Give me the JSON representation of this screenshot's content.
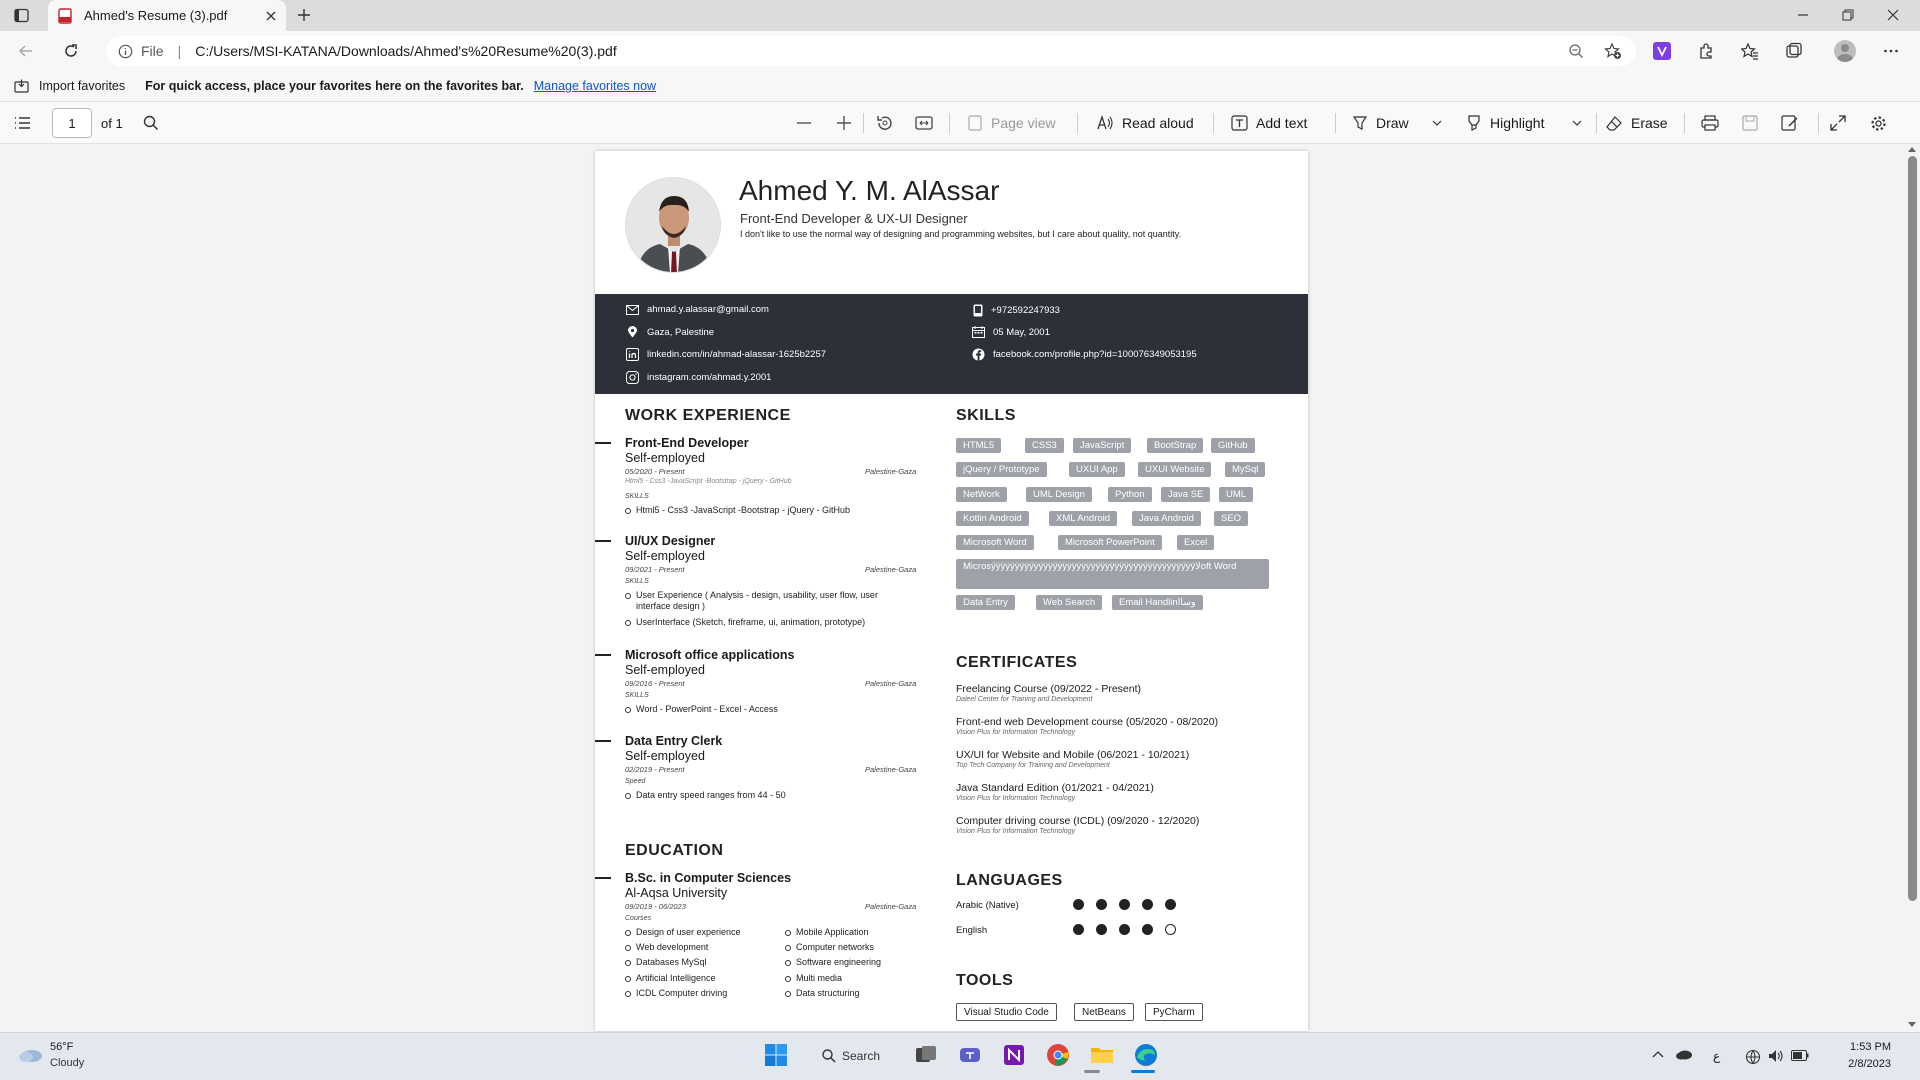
{
  "browser": {
    "tab_title": "Ahmed's Resume (3).pdf",
    "file_label": "File",
    "url": "C:/Users/MSI-KATANA/Downloads/Ahmed's%20Resume%20(3).pdf"
  },
  "favorites": {
    "import_label": "Import favorites",
    "message": "For quick access, place your favorites here on the favorites bar.",
    "manage_link": "Manage favorites now"
  },
  "pdf_toolbar": {
    "page_number": "1",
    "page_count": "of 1",
    "page_view": "Page view",
    "read_aloud": "Read aloud",
    "add_text": "Add text",
    "draw": "Draw",
    "highlight": "Highlight",
    "erase": "Erase"
  },
  "resume": {
    "name": "Ahmed Y. M. AlAssar",
    "role": "Front-End Developer & UX-UI Designer",
    "motto": "I don't like to use the normal way of designing and programming websites, but I care about quality, not quantity.",
    "contacts": {
      "email": "ahmad.y.alassar@gmail.com",
      "location": "Gaza, Palestine",
      "linkedin": "linkedin.com/in/ahmad-alassar-1625b2257",
      "instagram": "instagram.com/ahmad.y.2001",
      "phone": "+972592247933",
      "birthdate": "05 May, 2001",
      "facebook": "facebook.com/profile.php?id=100076349053195"
    },
    "work_heading": "WORK EXPERIENCE",
    "jobs": [
      {
        "title": "Front-End Developer",
        "company": "Self-employed",
        "dates": "05/2020 - Present",
        "location": "Palestine-Gaza",
        "note": "Html5 - Css3 -JavaScript -Bootstrap - jQuery - GitHub",
        "section": "SKILLS",
        "bullets": [
          "Html5 - Css3 -JavaScript -Bootstrap - jQuery - GitHub"
        ]
      },
      {
        "title": "UI/UX Designer",
        "company": "Self-employed",
        "dates": "09/2021 - Present",
        "location": "Palestine-Gaza",
        "section": "SKILLS",
        "bullets": [
          "User Experience ( Analysis - design, usability, user flow, user interface design )",
          "UserInterface (Sketch, fireframe, ui, animation, prototype)"
        ]
      },
      {
        "title": "Microsoft office applications",
        "company": "Self-employed",
        "dates": "09/2016 - Present",
        "location": "Palestine-Gaza",
        "section": "SKILLS",
        "bullets": [
          "Word - PowerPoint - Excel - Access"
        ]
      },
      {
        "title": "Data Entry Clerk",
        "company": "Self-employed",
        "dates": "02/2019 - Present",
        "location": "Palestine-Gaza",
        "section": "Speed",
        "bullets": [
          "Data entry speed ranges from 44 - 50"
        ]
      }
    ],
    "education_heading": "EDUCATION",
    "education": {
      "degree": "B.Sc. in Computer Sciences",
      "school": "Al-Aqsa University",
      "dates": "09/2019 - 06/2023",
      "location": "Palestine-Gaza",
      "section": "Courses",
      "courses_left": [
        "Design of user experience",
        "Web development",
        "Databases MySql",
        "Artificial Intelligence",
        "ICDL Computer driving"
      ],
      "courses_right": [
        "Mobile Application",
        "Computer networks",
        "Software engineering",
        "Multi media",
        "Data structuring"
      ]
    },
    "skills_heading": "SKILLS",
    "skills": [
      "HTML5",
      "CSS3",
      "JavaScript",
      "BootStrap",
      "GitHub",
      "jQuery / Prototype",
      "UXUI App",
      "UXUI Website",
      "MySql",
      "NetWork",
      "UML Design",
      "Python",
      "Java SE",
      "UML",
      "Kotlin Android",
      "XML Android",
      "Java Android",
      "SEO",
      "Microsoft Word",
      "Microsoft PowerPoint",
      "Excel",
      "Microsÿÿÿÿÿÿÿÿÿÿÿÿÿÿÿÿÿÿÿÿÿÿÿÿÿÿÿÿÿÿÿÿÿÿÿÿÿÿÿÿÿÿÿ﻿لاoft Word",
      "Data Entry",
      "Web Search",
      "Email Handlinوساا"
    ],
    "certificates_heading": "CERTIFICATES",
    "certificates": [
      {
        "title": "Freelancing Course (09/2022 - Present)",
        "org": "Daleel Center for Training and Development"
      },
      {
        "title": "Front-end web Development course (05/2020 - 08/2020)",
        "org": "Vision Plus for Information Technology"
      },
      {
        "title": "UX/UI for Website and Mobile (06/2021 - 10/2021)",
        "org": "Top Tech Company for Training and Development"
      },
      {
        "title": "Java Standard Edition (01/2021 - 04/2021)",
        "org": "Vision Plus for Information Technology"
      },
      {
        "title": "Computer driving course (ICDL) (09/2020 - 12/2020)",
        "org": "Vision Plus for Information Technology"
      }
    ],
    "languages_heading": "LANGUAGES",
    "languages": [
      {
        "name": "Arabic (Native)",
        "level": 5,
        "max": 5
      },
      {
        "name": "English",
        "level": 4,
        "max": 5
      }
    ],
    "tools_heading": "TOOLS",
    "tools": [
      "Visual Studio Code",
      "NetBeans",
      "PyCharm"
    ]
  },
  "taskbar": {
    "temperature": "56°F",
    "weather": "Cloudy",
    "search": "Search",
    "time": "1:53 PM",
    "date": "2/8/2023",
    "lang": "ع"
  },
  "colors": {
    "contact_band": "#2c3139",
    "tag_bg": "#9ea2a8",
    "link": "#0b57d0"
  }
}
